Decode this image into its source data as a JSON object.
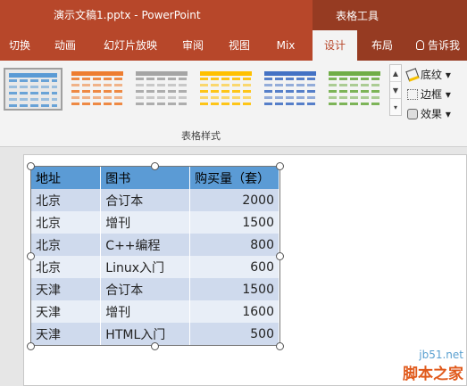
{
  "window": {
    "title": "演示文稿1.pptx - PowerPoint",
    "context_tab_group": "表格工具"
  },
  "tabs": [
    {
      "label": "切换"
    },
    {
      "label": "动画"
    },
    {
      "label": "幻灯片放映"
    },
    {
      "label": "审阅"
    },
    {
      "label": "视图"
    },
    {
      "label": "Mix"
    },
    {
      "label": "设计",
      "active": true
    },
    {
      "label": "布局"
    }
  ],
  "tell_me": "告诉我",
  "ribbon": {
    "group_label": "表格样式",
    "styles": [
      {
        "color": "#5b9bd5",
        "selected": true
      },
      {
        "color": "#ed7d31"
      },
      {
        "color": "#a5a5a5"
      },
      {
        "color": "#ffc000"
      },
      {
        "color": "#4472c4"
      },
      {
        "color": "#70ad47"
      }
    ],
    "shading_label": "底纹",
    "borders_label": "边框",
    "effects_label": "效果"
  },
  "table": {
    "headers": [
      "地址",
      "图书",
      "购买量（套）"
    ],
    "rows": [
      [
        "北京",
        "合订本",
        "2000"
      ],
      [
        "北京",
        "增刊",
        "1500"
      ],
      [
        "北京",
        "C++编程",
        "800"
      ],
      [
        "北京",
        "Linux入门",
        "600"
      ],
      [
        "天津",
        "合订本",
        "1500"
      ],
      [
        "天津",
        "增刊",
        "1600"
      ],
      [
        "天津",
        "HTML入门",
        "500"
      ]
    ]
  },
  "watermark": {
    "site": "jb51.net",
    "brand": "脚本之家"
  },
  "colors": {
    "accent": "#b7472a",
    "context_tab": "#963b22",
    "table_header": "#5b9bd5",
    "table_band_dark": "#cfdaed",
    "table_band_light": "#e8eef7"
  }
}
